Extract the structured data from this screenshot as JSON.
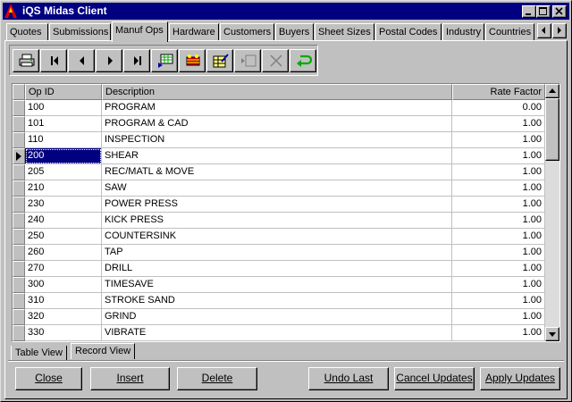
{
  "window": {
    "title": "iQS Midas Client"
  },
  "tabs": [
    "Quotes",
    "Submissions",
    "Manuf Ops",
    "Hardware",
    "Customers",
    "Buyers",
    "Sheet Sizes",
    "Postal Codes",
    "Industry",
    "Countries"
  ],
  "active_tab": "Manuf Ops",
  "toolbar": {
    "icons": [
      "printer-icon",
      "first-record-icon",
      "prior-record-icon",
      "next-record-icon",
      "last-record-icon",
      "export-grid-icon",
      "delete-records-icon",
      "edit-table-icon",
      "post-record-icon",
      "cancel-edit-icon",
      "refresh-icon"
    ]
  },
  "grid": {
    "columns": [
      "Op ID",
      "Description",
      "Rate Factor"
    ],
    "rows": [
      {
        "id": "100",
        "desc": "PROGRAM",
        "rate": "0.00"
      },
      {
        "id": "101",
        "desc": "PROGRAM & CAD",
        "rate": "1.00"
      },
      {
        "id": "110",
        "desc": "INSPECTION",
        "rate": "1.00"
      },
      {
        "id": "200",
        "desc": "SHEAR",
        "rate": "1.00"
      },
      {
        "id": "205",
        "desc": "REC/MATL & MOVE",
        "rate": "1.00"
      },
      {
        "id": "210",
        "desc": "SAW",
        "rate": "1.00"
      },
      {
        "id": "230",
        "desc": "POWER PRESS",
        "rate": "1.00"
      },
      {
        "id": "240",
        "desc": "KICK PRESS",
        "rate": "1.00"
      },
      {
        "id": "250",
        "desc": "COUNTERSINK",
        "rate": "1.00"
      },
      {
        "id": "260",
        "desc": "TAP",
        "rate": "1.00"
      },
      {
        "id": "270",
        "desc": "DRILL",
        "rate": "1.00"
      },
      {
        "id": "300",
        "desc": "TIMESAVE",
        "rate": "1.00"
      },
      {
        "id": "310",
        "desc": "STROKE SAND",
        "rate": "1.00"
      },
      {
        "id": "320",
        "desc": "GRIND",
        "rate": "1.00"
      },
      {
        "id": "330",
        "desc": "VIBRATE",
        "rate": "1.00"
      }
    ],
    "current_row_index": 3
  },
  "view_tabs": {
    "table": "Table View",
    "record": "Record View",
    "active": "Table View"
  },
  "buttons": {
    "close": "Close",
    "insert": "Insert",
    "delete": "Delete",
    "undo_last": "Undo Last",
    "cancel_updates": "Cancel Updates",
    "apply_updates": "Apply Updates"
  },
  "colors": {
    "titlebar": "#000080",
    "selection": "#000080",
    "face": "#c0c0c0"
  }
}
